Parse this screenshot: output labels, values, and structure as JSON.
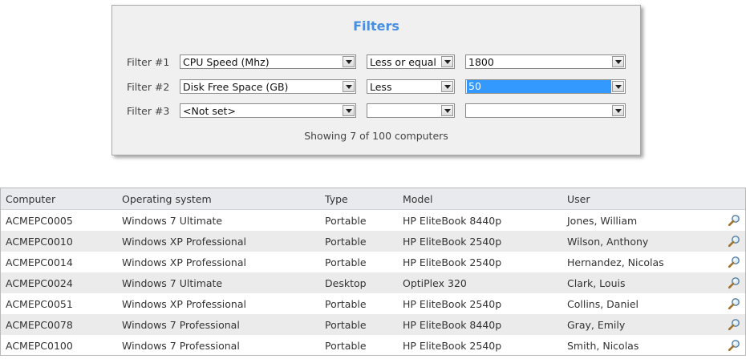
{
  "filters": {
    "title": "Filters",
    "rows": [
      {
        "label": "Filter #1",
        "field": "CPU Speed (Mhz)",
        "operator": "Less or equal",
        "value": "1800"
      },
      {
        "label": "Filter #2",
        "field": "Disk Free Space (GB)",
        "operator": "Less",
        "value": "50"
      },
      {
        "label": "Filter #3",
        "field": "<Not set>",
        "operator": "",
        "value": ""
      }
    ],
    "status": "Showing 7 of 100 computers"
  },
  "table": {
    "headers": [
      "Computer",
      "Operating system",
      "Type",
      "Model",
      "User"
    ],
    "rows": [
      [
        "ACMEPC0005",
        "Windows 7 Ultimate",
        "Portable",
        "HP EliteBook 8440p",
        "Jones, William"
      ],
      [
        "ACMEPC0010",
        "Windows XP Professional",
        "Portable",
        "HP EliteBook 2540p",
        "Wilson, Anthony"
      ],
      [
        "ACMEPC0014",
        "Windows XP Professional",
        "Portable",
        "HP EliteBook 2540p",
        "Hernandez, Nicolas"
      ],
      [
        "ACMEPC0024",
        "Windows 7 Ultimate",
        "Desktop",
        "OptiPlex 320",
        "Clark, Louis"
      ],
      [
        "ACMEPC0051",
        "Windows XP Professional",
        "Portable",
        "HP EliteBook 2540p",
        "Collins, Daniel"
      ],
      [
        "ACMEPC0078",
        "Windows 7 Professional",
        "Portable",
        "HP EliteBook 8440p",
        "Gray, Emily"
      ],
      [
        "ACMEPC0100",
        "Windows 7 Professional",
        "Portable",
        "HP EliteBook 2540p",
        "Smith, Nicolas"
      ]
    ],
    "row_icon": "magnifier-icon"
  },
  "colors": {
    "title": "#4a8ee0",
    "selection": "#3399ff",
    "alt_row": "#ebebeb",
    "header_bg": "#e8eaee"
  }
}
